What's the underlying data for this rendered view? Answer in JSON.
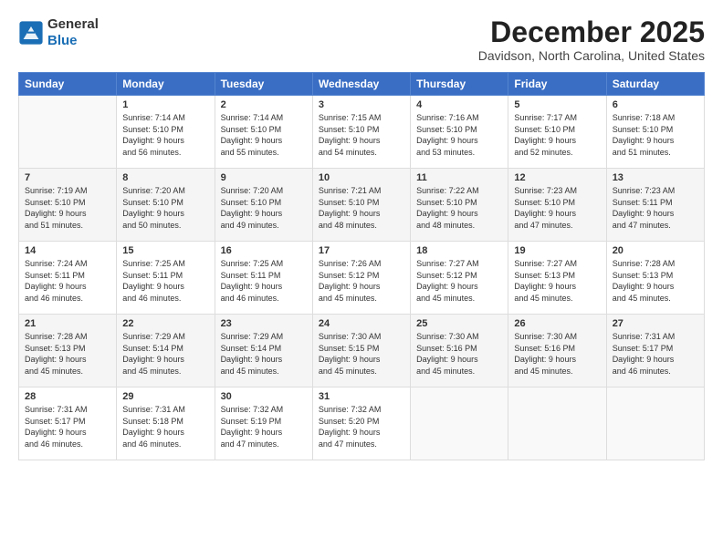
{
  "logo": {
    "general": "General",
    "blue": "Blue"
  },
  "header": {
    "month_title": "December 2025",
    "location": "Davidson, North Carolina, United States"
  },
  "days_of_week": [
    "Sunday",
    "Monday",
    "Tuesday",
    "Wednesday",
    "Thursday",
    "Friday",
    "Saturday"
  ],
  "weeks": [
    [
      {
        "day": "",
        "info": ""
      },
      {
        "day": "1",
        "info": "Sunrise: 7:14 AM\nSunset: 5:10 PM\nDaylight: 9 hours\nand 56 minutes."
      },
      {
        "day": "2",
        "info": "Sunrise: 7:14 AM\nSunset: 5:10 PM\nDaylight: 9 hours\nand 55 minutes."
      },
      {
        "day": "3",
        "info": "Sunrise: 7:15 AM\nSunset: 5:10 PM\nDaylight: 9 hours\nand 54 minutes."
      },
      {
        "day": "4",
        "info": "Sunrise: 7:16 AM\nSunset: 5:10 PM\nDaylight: 9 hours\nand 53 minutes."
      },
      {
        "day": "5",
        "info": "Sunrise: 7:17 AM\nSunset: 5:10 PM\nDaylight: 9 hours\nand 52 minutes."
      },
      {
        "day": "6",
        "info": "Sunrise: 7:18 AM\nSunset: 5:10 PM\nDaylight: 9 hours\nand 51 minutes."
      }
    ],
    [
      {
        "day": "7",
        "info": "Sunrise: 7:19 AM\nSunset: 5:10 PM\nDaylight: 9 hours\nand 51 minutes."
      },
      {
        "day": "8",
        "info": "Sunrise: 7:20 AM\nSunset: 5:10 PM\nDaylight: 9 hours\nand 50 minutes."
      },
      {
        "day": "9",
        "info": "Sunrise: 7:20 AM\nSunset: 5:10 PM\nDaylight: 9 hours\nand 49 minutes."
      },
      {
        "day": "10",
        "info": "Sunrise: 7:21 AM\nSunset: 5:10 PM\nDaylight: 9 hours\nand 48 minutes."
      },
      {
        "day": "11",
        "info": "Sunrise: 7:22 AM\nSunset: 5:10 PM\nDaylight: 9 hours\nand 48 minutes."
      },
      {
        "day": "12",
        "info": "Sunrise: 7:23 AM\nSunset: 5:10 PM\nDaylight: 9 hours\nand 47 minutes."
      },
      {
        "day": "13",
        "info": "Sunrise: 7:23 AM\nSunset: 5:11 PM\nDaylight: 9 hours\nand 47 minutes."
      }
    ],
    [
      {
        "day": "14",
        "info": "Sunrise: 7:24 AM\nSunset: 5:11 PM\nDaylight: 9 hours\nand 46 minutes."
      },
      {
        "day": "15",
        "info": "Sunrise: 7:25 AM\nSunset: 5:11 PM\nDaylight: 9 hours\nand 46 minutes."
      },
      {
        "day": "16",
        "info": "Sunrise: 7:25 AM\nSunset: 5:11 PM\nDaylight: 9 hours\nand 46 minutes."
      },
      {
        "day": "17",
        "info": "Sunrise: 7:26 AM\nSunset: 5:12 PM\nDaylight: 9 hours\nand 45 minutes."
      },
      {
        "day": "18",
        "info": "Sunrise: 7:27 AM\nSunset: 5:12 PM\nDaylight: 9 hours\nand 45 minutes."
      },
      {
        "day": "19",
        "info": "Sunrise: 7:27 AM\nSunset: 5:13 PM\nDaylight: 9 hours\nand 45 minutes."
      },
      {
        "day": "20",
        "info": "Sunrise: 7:28 AM\nSunset: 5:13 PM\nDaylight: 9 hours\nand 45 minutes."
      }
    ],
    [
      {
        "day": "21",
        "info": "Sunrise: 7:28 AM\nSunset: 5:13 PM\nDaylight: 9 hours\nand 45 minutes."
      },
      {
        "day": "22",
        "info": "Sunrise: 7:29 AM\nSunset: 5:14 PM\nDaylight: 9 hours\nand 45 minutes."
      },
      {
        "day": "23",
        "info": "Sunrise: 7:29 AM\nSunset: 5:14 PM\nDaylight: 9 hours\nand 45 minutes."
      },
      {
        "day": "24",
        "info": "Sunrise: 7:30 AM\nSunset: 5:15 PM\nDaylight: 9 hours\nand 45 minutes."
      },
      {
        "day": "25",
        "info": "Sunrise: 7:30 AM\nSunset: 5:16 PM\nDaylight: 9 hours\nand 45 minutes."
      },
      {
        "day": "26",
        "info": "Sunrise: 7:30 AM\nSunset: 5:16 PM\nDaylight: 9 hours\nand 45 minutes."
      },
      {
        "day": "27",
        "info": "Sunrise: 7:31 AM\nSunset: 5:17 PM\nDaylight: 9 hours\nand 46 minutes."
      }
    ],
    [
      {
        "day": "28",
        "info": "Sunrise: 7:31 AM\nSunset: 5:17 PM\nDaylight: 9 hours\nand 46 minutes."
      },
      {
        "day": "29",
        "info": "Sunrise: 7:31 AM\nSunset: 5:18 PM\nDaylight: 9 hours\nand 46 minutes."
      },
      {
        "day": "30",
        "info": "Sunrise: 7:32 AM\nSunset: 5:19 PM\nDaylight: 9 hours\nand 47 minutes."
      },
      {
        "day": "31",
        "info": "Sunrise: 7:32 AM\nSunset: 5:20 PM\nDaylight: 9 hours\nand 47 minutes."
      },
      {
        "day": "",
        "info": ""
      },
      {
        "day": "",
        "info": ""
      },
      {
        "day": "",
        "info": ""
      }
    ]
  ]
}
